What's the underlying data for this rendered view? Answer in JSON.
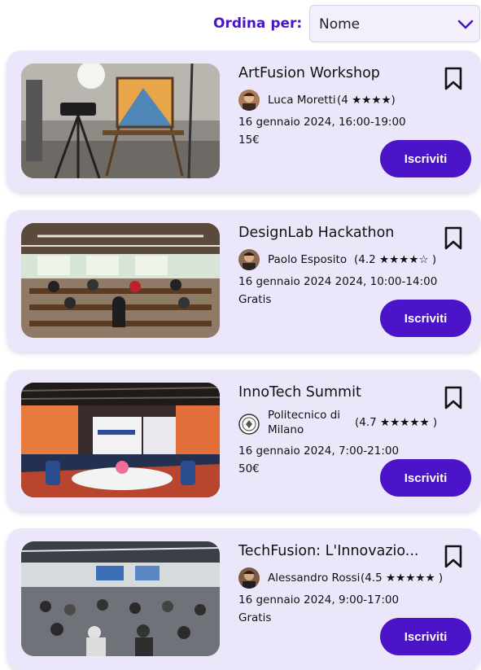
{
  "sort": {
    "label": "Ordina per:",
    "value": "Nome"
  },
  "events": [
    {
      "title": "ArtFusion Workshop",
      "organizer": "Luca Moretti",
      "rating_text": "(4 ★★★★)",
      "date": "16 gennaio 2024, 16:00-19:00",
      "price": "15€",
      "button": "Iscriviti",
      "image": "photography-studio-easel-painting"
    },
    {
      "title": "DesignLab Hackathon",
      "organizer": "Paolo Esposito",
      "rating_text": "(4.2 ★★★★☆ )",
      "date": "16 gennaio 2024 2024, 10:00-14:00",
      "price": "Gratis",
      "button": "Iscriviti",
      "image": "hackathon-room-people-at-desks"
    },
    {
      "title": "InnoTech Summit",
      "organizer_line1": "Politecnico di",
      "organizer_line2": "Milano",
      "rating_text": "(4.7 ★★★★★ )",
      "date": "16 gennaio 2024, 7:00-21:00",
      "price": "50€",
      "button": "Iscriviti",
      "image": "conference-hall-round-tables"
    },
    {
      "title": "TechFusion: L'Innovazio...",
      "organizer": "Alessandro Rossi",
      "rating_text": "(4.5 ★★★★★ )",
      "date": "16 gennaio 2024, 9:00-17:00",
      "price": "Gratis",
      "button": "Iscriviti",
      "image": "large-audience-event-hall"
    }
  ],
  "colors": {
    "accent": "#4b14c8",
    "card_bg": "#ece6fb"
  }
}
